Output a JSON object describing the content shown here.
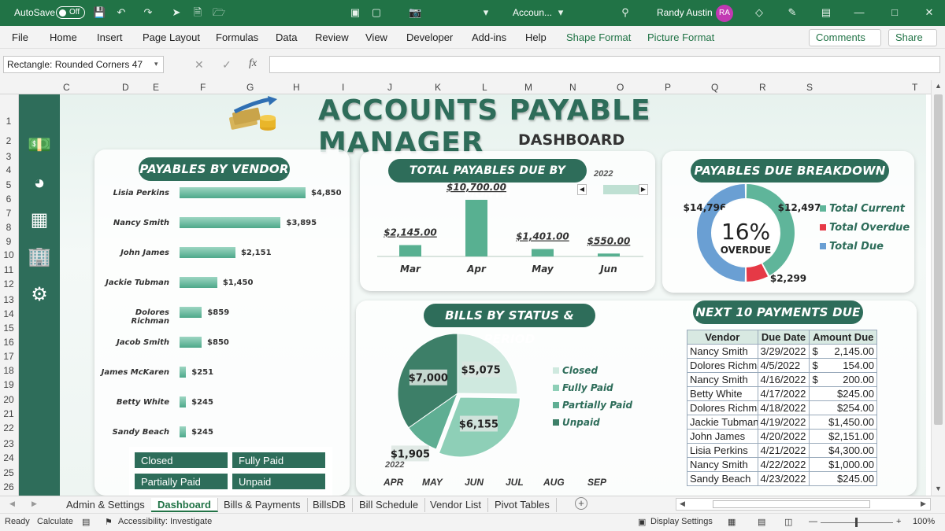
{
  "titlebar": {
    "autosave_label": "AutoSave",
    "autosave_state": "Off",
    "doc_title": "Accoun...",
    "user_name": "Randy Austin",
    "user_initials": "RA"
  },
  "menu": [
    "File",
    "Home",
    "Insert",
    "Page Layout",
    "Formulas",
    "Data",
    "Review",
    "View",
    "Developer",
    "Add-ins",
    "Help",
    "Shape Format",
    "Picture Format"
  ],
  "menu_right": {
    "comments": "Comments",
    "share": "Share"
  },
  "formula_bar": {
    "name_box": "Rectangle: Rounded Corners 47",
    "fx": "fx"
  },
  "columns": [
    "C",
    "D",
    "E",
    "F",
    "G",
    "H",
    "I",
    "J",
    "K",
    "L",
    "M",
    "N",
    "O",
    "P",
    "Q",
    "R",
    "S",
    "T"
  ],
  "rows": [
    "1",
    "2",
    "3",
    "4",
    "5",
    "6",
    "7",
    "8",
    "9",
    "10",
    "11",
    "12",
    "13",
    "14",
    "15",
    "16",
    "17",
    "18",
    "19",
    "20",
    "21",
    "22",
    "23",
    "24",
    "25",
    "26"
  ],
  "dashboard": {
    "title": "ACCOUNTS PAYABLE MANAGER",
    "subtitle": "DASHBOARD",
    "vendor_panel_title": "PAYABLES BY VENDOR",
    "month_panel_title": "TOTAL PAYABLES DUE BY MONTH",
    "month_year": "2022",
    "breakdown_title": "PAYABLES DUE BREAKDOWN",
    "status_title": "BILLS BY STATUS & PERIOD",
    "next_title": "NEXT 10 PAYMENTS DUE",
    "status_buttons": [
      "Closed",
      "Fully Paid",
      "Partially Paid",
      "Unpaid"
    ]
  },
  "vendors": [
    {
      "name": "Lisia Perkins",
      "label": "$4,850",
      "value": 4850
    },
    {
      "name": "Nancy Smith",
      "label": "$3,895",
      "value": 3895
    },
    {
      "name": "John James",
      "label": "$2,151",
      "value": 2151
    },
    {
      "name": "Jackie Tubman",
      "label": "$1,450",
      "value": 1450
    },
    {
      "name": "Dolores Richman",
      "label": "$859",
      "value": 859
    },
    {
      "name": "Jacob Smith",
      "label": "$850",
      "value": 850
    },
    {
      "name": "James McKaren",
      "label": "$251",
      "value": 251
    },
    {
      "name": "Betty White",
      "label": "$245",
      "value": 245
    },
    {
      "name": "Sandy Beach",
      "label": "$245",
      "value": 245
    }
  ],
  "chart_data": [
    {
      "type": "bar",
      "title": "TOTAL PAYABLES DUE BY MONTH",
      "categories": [
        "Mar",
        "Apr",
        "May",
        "Jun"
      ],
      "values": [
        2145,
        10700,
        1401,
        550
      ],
      "labels": [
        "$2,145.00",
        "$10,700.00",
        "$1,401.00",
        "$550.00"
      ]
    },
    {
      "type": "pie",
      "title": "PAYABLES DUE BREAKDOWN",
      "center_value": "16%",
      "center_label": "OVERDUE",
      "slices": [
        {
          "name": "Total Current",
          "value": 12497,
          "label": "$12,497",
          "color": "#5fb59a"
        },
        {
          "name": "Total Overdue",
          "value": 2299,
          "label": "$2,299",
          "color": "#e63946"
        },
        {
          "name": "Total Due",
          "value": 14796,
          "label": "$14,796",
          "color": "#6a9fd3"
        }
      ]
    },
    {
      "type": "pie",
      "title": "BILLS BY STATUS & PERIOD",
      "slices": [
        {
          "name": "Closed",
          "value": 5075,
          "label": "$5,075",
          "color": "#cfe9df"
        },
        {
          "name": "Fully Paid",
          "value": 6155,
          "label": "$6,155",
          "color": "#8ecfb7"
        },
        {
          "name": "Partially Paid",
          "value": 1905,
          "label": "$1,905",
          "color": "#5fae93"
        },
        {
          "name": "Unpaid",
          "value": 7000,
          "label": "$7,000",
          "color": "#3d7f68"
        }
      ],
      "period_year": "2022",
      "period_months": [
        "APR",
        "MAY",
        "JUN",
        "JUL",
        "AUG",
        "SEP"
      ]
    }
  ],
  "payments": {
    "headers": [
      "Vendor",
      "Due Date",
      "Amount Due"
    ],
    "rows": [
      [
        "Nancy Smith",
        "3/29/2022",
        "$",
        "2,145.00"
      ],
      [
        "Dolores Richma",
        "4/5/2022",
        "$",
        "154.00"
      ],
      [
        "Nancy Smith",
        "4/16/2022",
        "$",
        "200.00"
      ],
      [
        "Betty White",
        "4/17/2022",
        "",
        "$245.00"
      ],
      [
        "Dolores Richma",
        "4/18/2022",
        "",
        "$254.00"
      ],
      [
        "Jackie Tubman",
        "4/19/2022",
        "",
        "$1,450.00"
      ],
      [
        "John James",
        "4/20/2022",
        "",
        "$2,151.00"
      ],
      [
        "Lisia Perkins",
        "4/21/2022",
        "",
        "$4,300.00"
      ],
      [
        "Nancy Smith",
        "4/22/2022",
        "",
        "$1,000.00"
      ],
      [
        "Sandy Beach",
        "4/23/2022",
        "",
        "$245.00"
      ]
    ]
  },
  "sheet_tabs": [
    "Admin & Settings",
    "Dashboard",
    "Bills & Payments",
    "BillsDB",
    "Bill Schedule",
    "Vendor List",
    "Pivot Tables"
  ],
  "active_tab": "Dashboard",
  "status": {
    "ready": "Ready",
    "calculate": "Calculate",
    "accessibility": "Accessibility: Investigate",
    "display": "Display Settings",
    "zoom": "100%"
  }
}
